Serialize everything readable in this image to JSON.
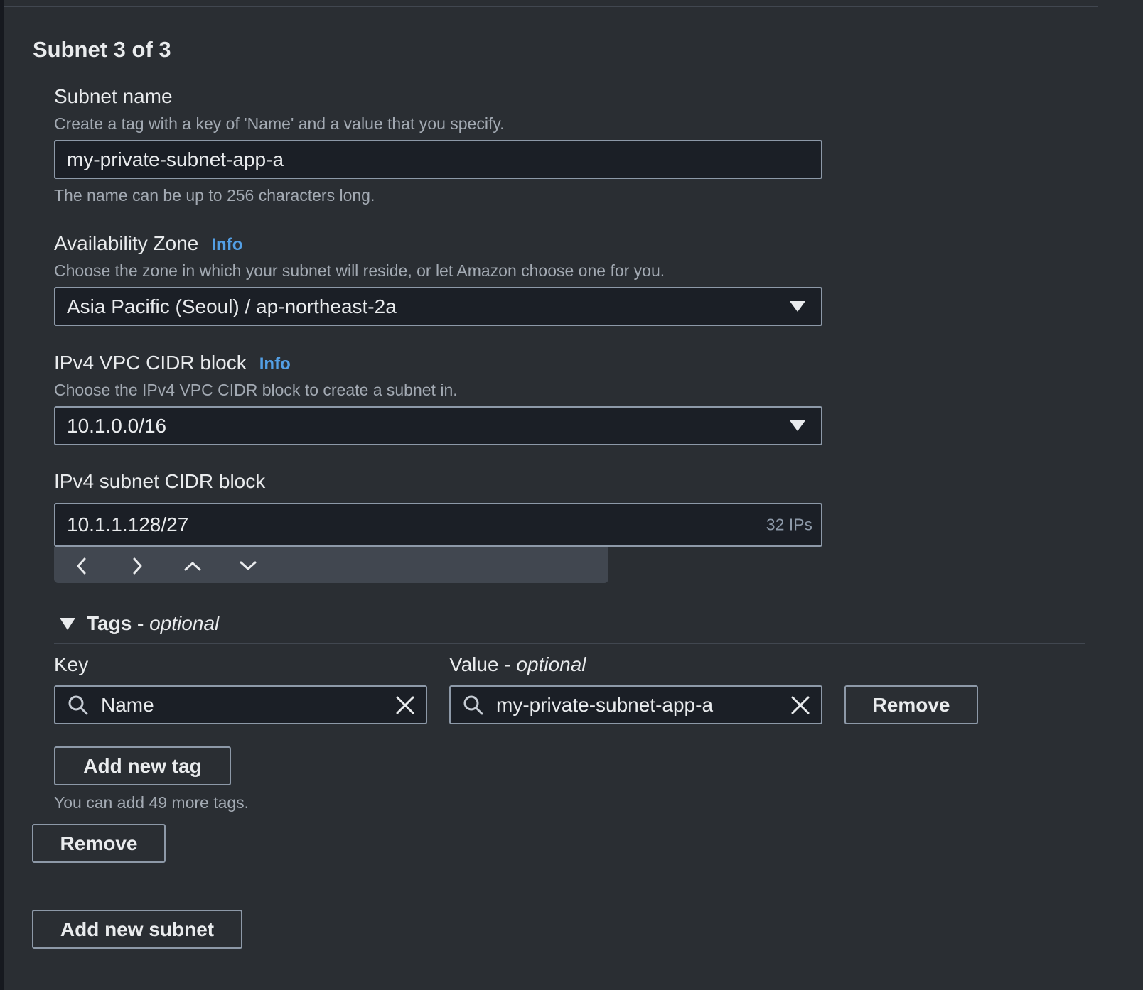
{
  "section": {
    "title": "Subnet 3 of 3"
  },
  "subnet_name": {
    "label": "Subnet name",
    "description": "Create a tag with a key of 'Name' and a value that you specify.",
    "value": "my-private-subnet-app-a",
    "hint": "The name can be up to 256 characters long."
  },
  "availability_zone": {
    "label": "Availability Zone",
    "info": "Info",
    "description": "Choose the zone in which your subnet will reside, or let Amazon choose one for you.",
    "selected": "Asia Pacific (Seoul) / ap-northeast-2a",
    "icon": "caret-down-icon"
  },
  "vpc_cidr": {
    "label": "IPv4 VPC CIDR block",
    "info": "Info",
    "description": "Choose the IPv4 VPC CIDR block to create a subnet in.",
    "selected": "10.1.0.0/16",
    "icon": "caret-down-icon"
  },
  "subnet_cidr": {
    "label": "IPv4 subnet CIDR block",
    "value": "10.1.1.128/27",
    "suffix": "32 IPs",
    "stepper_icons": [
      "chevron-left-icon",
      "chevron-right-icon",
      "chevron-up-icon",
      "chevron-down-icon"
    ]
  },
  "tags": {
    "header": "Tags - ",
    "header_optional": "optional",
    "key_label": "Key",
    "value_label": "Value - ",
    "value_label_optional": "optional",
    "rows": [
      {
        "key": "Name",
        "value": "my-private-subnet-app-a",
        "remove_label": "Remove"
      }
    ],
    "add_label": "Add new tag",
    "limit_text": "You can add 49 more tags."
  },
  "actions": {
    "remove_subnet_label": "Remove",
    "add_subnet_label": "Add new subnet"
  },
  "colors": {
    "panel_bg": "#2a2e33",
    "field_bg": "#1b1f26",
    "border": "#8d99a8",
    "link": "#539fe5",
    "text": "#e9ebed",
    "muted": "#a3aab3"
  }
}
